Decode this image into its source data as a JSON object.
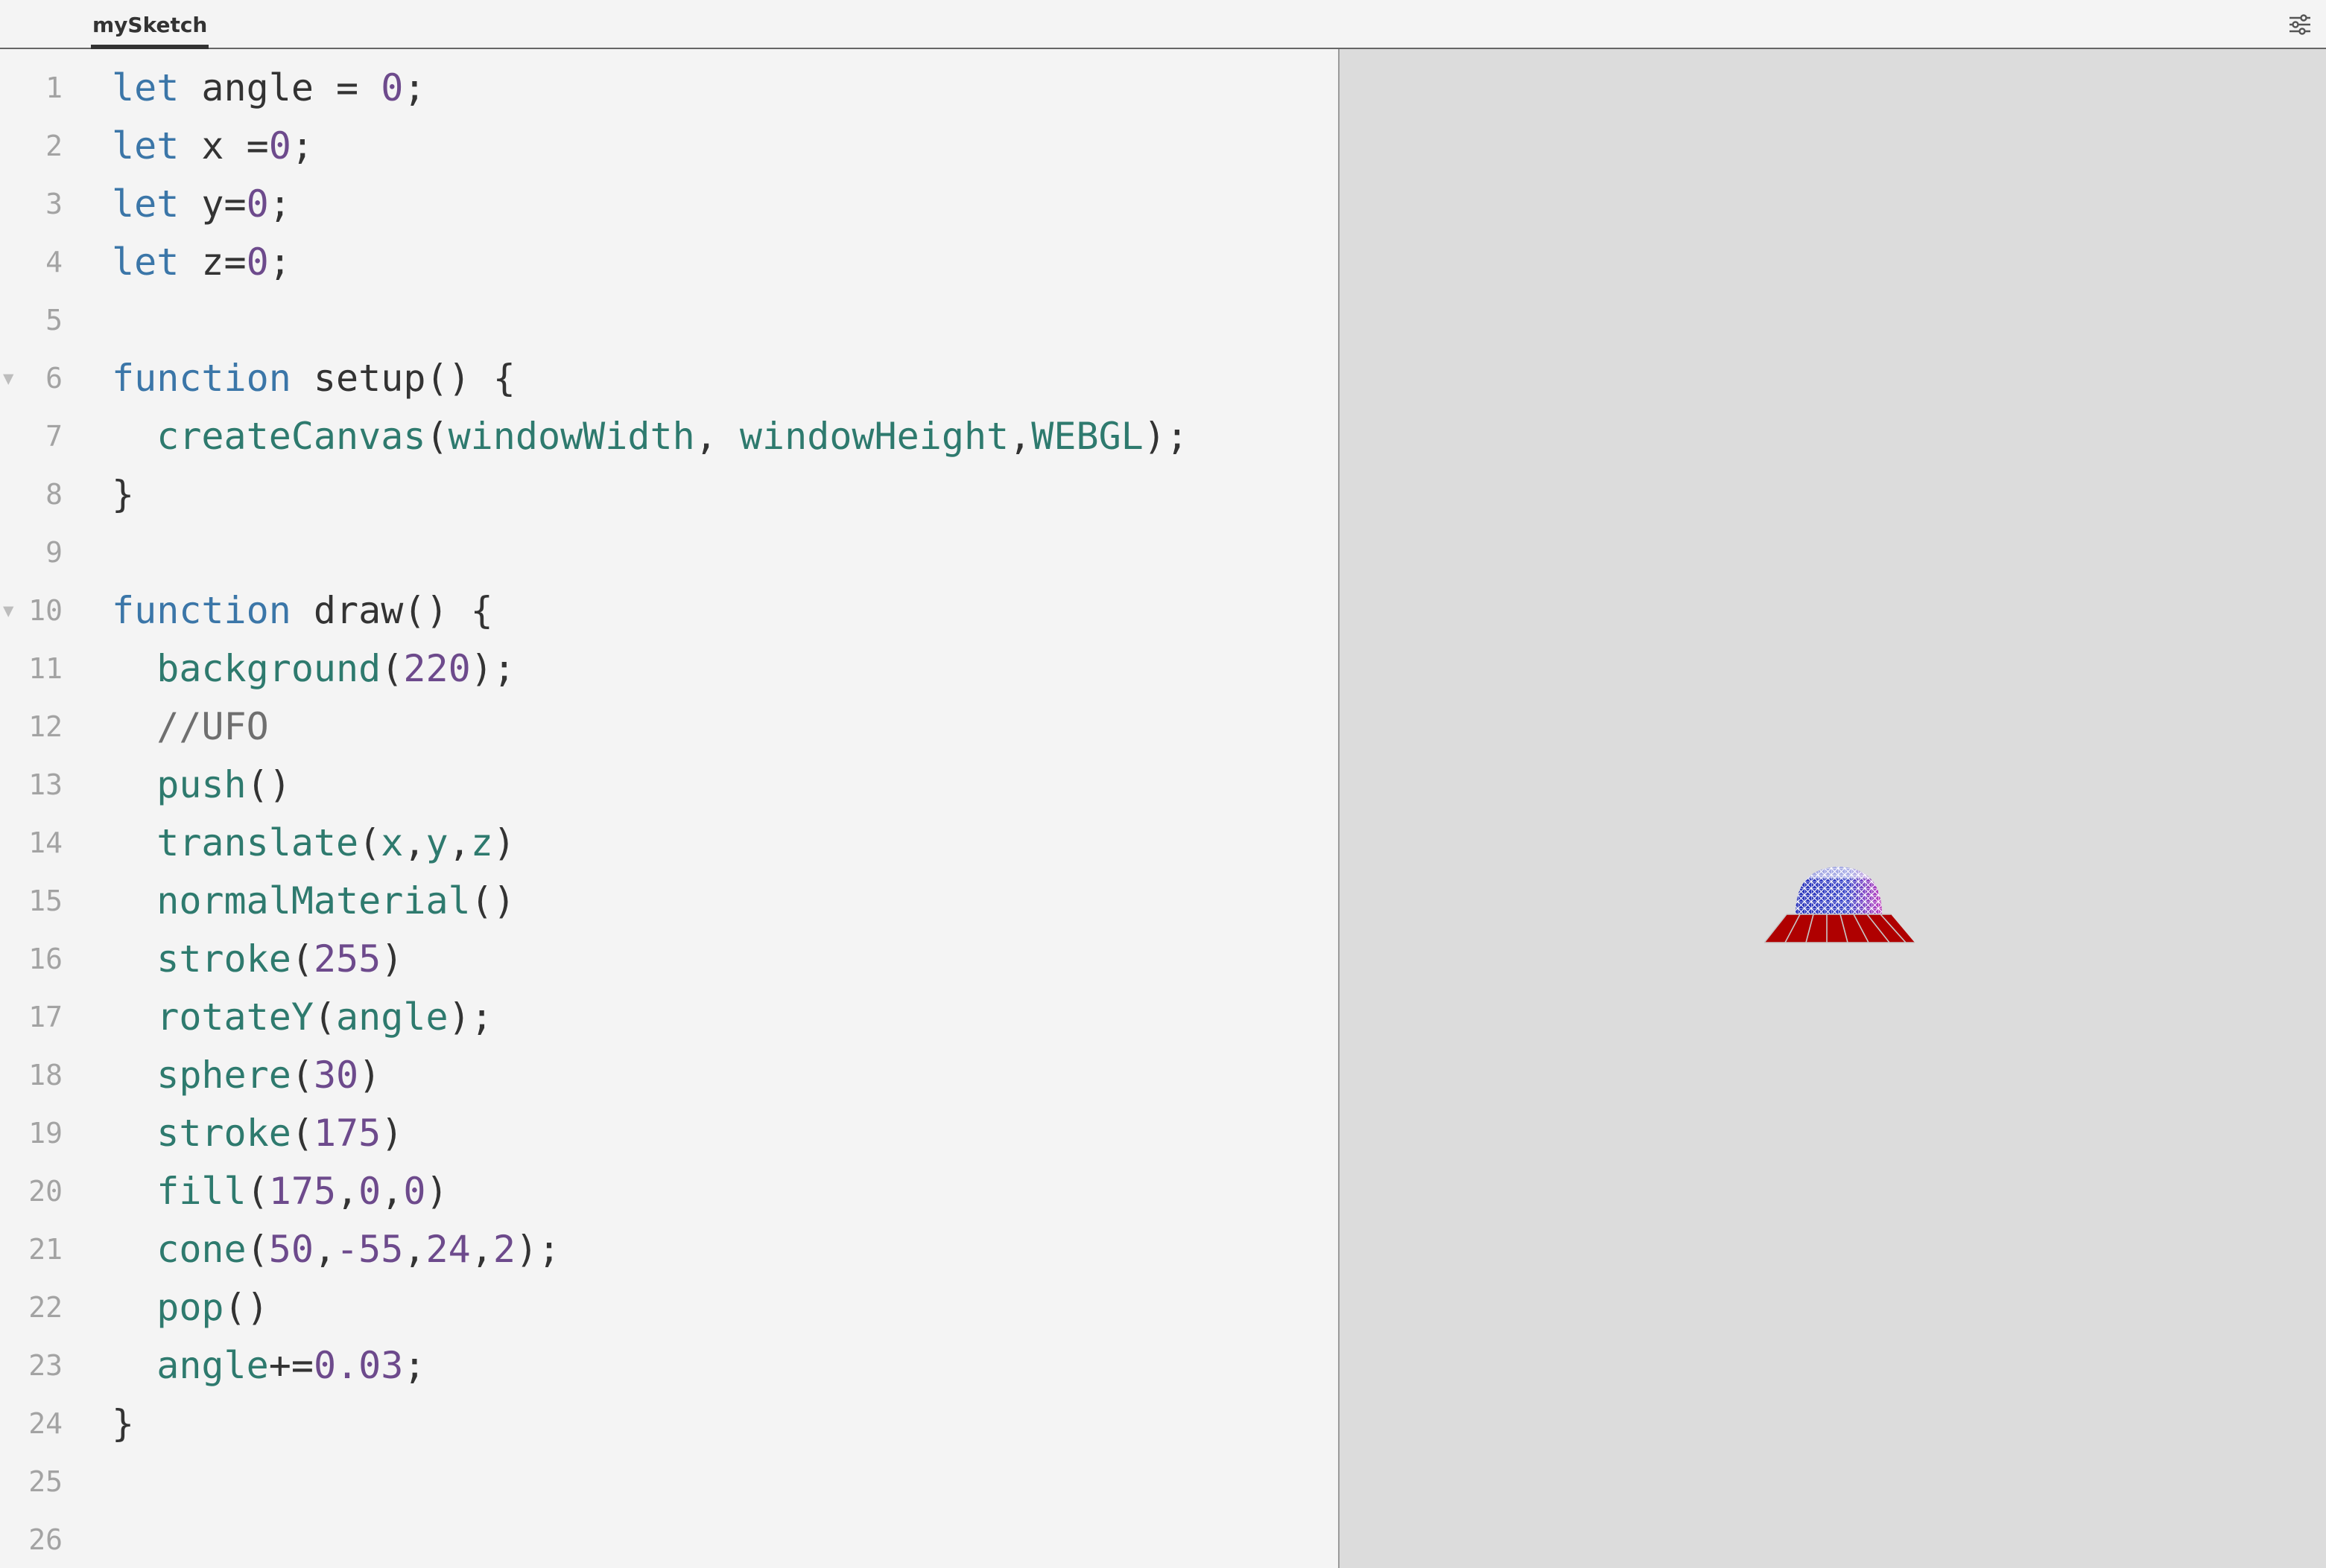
{
  "tab": {
    "title": "mySketch"
  },
  "settings_icon": "sliders-icon",
  "editor": {
    "lines": [
      {
        "n": "1",
        "fold": false,
        "tokens": [
          [
            "kw",
            "let"
          ],
          [
            "pl",
            " angle = "
          ],
          [
            "num",
            "0"
          ],
          [
            "pl",
            ";"
          ]
        ]
      },
      {
        "n": "2",
        "fold": false,
        "tokens": [
          [
            "kw",
            "let"
          ],
          [
            "pl",
            " x ="
          ],
          [
            "num",
            "0"
          ],
          [
            "pl",
            ";"
          ]
        ]
      },
      {
        "n": "3",
        "fold": false,
        "tokens": [
          [
            "kw",
            "let"
          ],
          [
            "pl",
            " y="
          ],
          [
            "num",
            "0"
          ],
          [
            "pl",
            ";"
          ]
        ]
      },
      {
        "n": "4",
        "fold": false,
        "tokens": [
          [
            "kw",
            "let"
          ],
          [
            "pl",
            " z="
          ],
          [
            "num",
            "0"
          ],
          [
            "pl",
            ";"
          ]
        ]
      },
      {
        "n": "5",
        "fold": false,
        "tokens": []
      },
      {
        "n": "6",
        "fold": true,
        "tokens": [
          [
            "kw",
            "function"
          ],
          [
            "pl",
            " setup() {"
          ]
        ]
      },
      {
        "n": "7",
        "fold": false,
        "tokens": [
          [
            "pl",
            "  "
          ],
          [
            "fn",
            "createCanvas"
          ],
          [
            "pl",
            "("
          ],
          [
            "fn",
            "windowWidth"
          ],
          [
            "pl",
            ", "
          ],
          [
            "fn",
            "windowHeight"
          ],
          [
            "pl",
            ","
          ],
          [
            "fn",
            "WEBGL"
          ],
          [
            "pl",
            ");"
          ]
        ]
      },
      {
        "n": "8",
        "fold": false,
        "tokens": [
          [
            "pl",
            "}"
          ]
        ]
      },
      {
        "n": "9",
        "fold": false,
        "tokens": []
      },
      {
        "n": "10",
        "fold": true,
        "tokens": [
          [
            "kw",
            "function"
          ],
          [
            "pl",
            " draw() {"
          ]
        ]
      },
      {
        "n": "11",
        "fold": false,
        "tokens": [
          [
            "pl",
            "  "
          ],
          [
            "fn",
            "background"
          ],
          [
            "pl",
            "("
          ],
          [
            "num",
            "220"
          ],
          [
            "pl",
            ");"
          ]
        ]
      },
      {
        "n": "12",
        "fold": false,
        "tokens": [
          [
            "pl",
            "  "
          ],
          [
            "cm",
            "//UFO"
          ]
        ]
      },
      {
        "n": "13",
        "fold": false,
        "tokens": [
          [
            "pl",
            "  "
          ],
          [
            "fn",
            "push"
          ],
          [
            "pl",
            "()"
          ]
        ]
      },
      {
        "n": "14",
        "fold": false,
        "tokens": [
          [
            "pl",
            "  "
          ],
          [
            "fn",
            "translate"
          ],
          [
            "pl",
            "("
          ],
          [
            "fn",
            "x"
          ],
          [
            "pl",
            ","
          ],
          [
            "fn",
            "y"
          ],
          [
            "pl",
            ","
          ],
          [
            "fn",
            "z"
          ],
          [
            "pl",
            ")"
          ]
        ]
      },
      {
        "n": "15",
        "fold": false,
        "tokens": [
          [
            "pl",
            "  "
          ],
          [
            "fn",
            "normalMaterial"
          ],
          [
            "pl",
            "()"
          ]
        ]
      },
      {
        "n": "16",
        "fold": false,
        "tokens": [
          [
            "pl",
            "  "
          ],
          [
            "fn",
            "stroke"
          ],
          [
            "pl",
            "("
          ],
          [
            "num",
            "255"
          ],
          [
            "pl",
            ")"
          ]
        ]
      },
      {
        "n": "17",
        "fold": false,
        "tokens": [
          [
            "pl",
            "  "
          ],
          [
            "fn",
            "rotateY"
          ],
          [
            "pl",
            "("
          ],
          [
            "fn",
            "angle"
          ],
          [
            "pl",
            ");"
          ]
        ]
      },
      {
        "n": "18",
        "fold": false,
        "tokens": [
          [
            "pl",
            "  "
          ],
          [
            "fn",
            "sphere"
          ],
          [
            "pl",
            "("
          ],
          [
            "num",
            "30"
          ],
          [
            "pl",
            ")"
          ]
        ]
      },
      {
        "n": "19",
        "fold": false,
        "tokens": [
          [
            "pl",
            "  "
          ],
          [
            "fn",
            "stroke"
          ],
          [
            "pl",
            "("
          ],
          [
            "num",
            "175"
          ],
          [
            "pl",
            ")"
          ]
        ]
      },
      {
        "n": "20",
        "fold": false,
        "tokens": [
          [
            "pl",
            "  "
          ],
          [
            "fn",
            "fill"
          ],
          [
            "pl",
            "("
          ],
          [
            "num",
            "175"
          ],
          [
            "pl",
            ","
          ],
          [
            "num",
            "0"
          ],
          [
            "pl",
            ","
          ],
          [
            "num",
            "0"
          ],
          [
            "pl",
            ")"
          ]
        ]
      },
      {
        "n": "21",
        "fold": false,
        "tokens": [
          [
            "pl",
            "  "
          ],
          [
            "fn",
            "cone"
          ],
          [
            "pl",
            "("
          ],
          [
            "num",
            "50"
          ],
          [
            "pl",
            ","
          ],
          [
            "num",
            "-55"
          ],
          [
            "pl",
            ","
          ],
          [
            "num",
            "24"
          ],
          [
            "pl",
            ","
          ],
          [
            "num",
            "2"
          ],
          [
            "pl",
            ");"
          ]
        ]
      },
      {
        "n": "22",
        "fold": false,
        "tokens": [
          [
            "pl",
            "  "
          ],
          [
            "fn",
            "pop"
          ],
          [
            "pl",
            "()"
          ]
        ]
      },
      {
        "n": "23",
        "fold": false,
        "tokens": [
          [
            "pl",
            "  "
          ],
          [
            "fn",
            "angle"
          ],
          [
            "pl",
            "+="
          ],
          [
            "num",
            "0.03"
          ],
          [
            "pl",
            ";"
          ]
        ]
      },
      {
        "n": "24",
        "fold": false,
        "tokens": [
          [
            "pl",
            "}"
          ]
        ]
      },
      {
        "n": "25",
        "fold": false,
        "tokens": []
      },
      {
        "n": "26",
        "fold": false,
        "tokens": []
      }
    ]
  },
  "preview": {
    "background": "#dcdcdc",
    "ufo_dome_color": "#3c46c8",
    "ufo_base_color": "#af0000"
  }
}
